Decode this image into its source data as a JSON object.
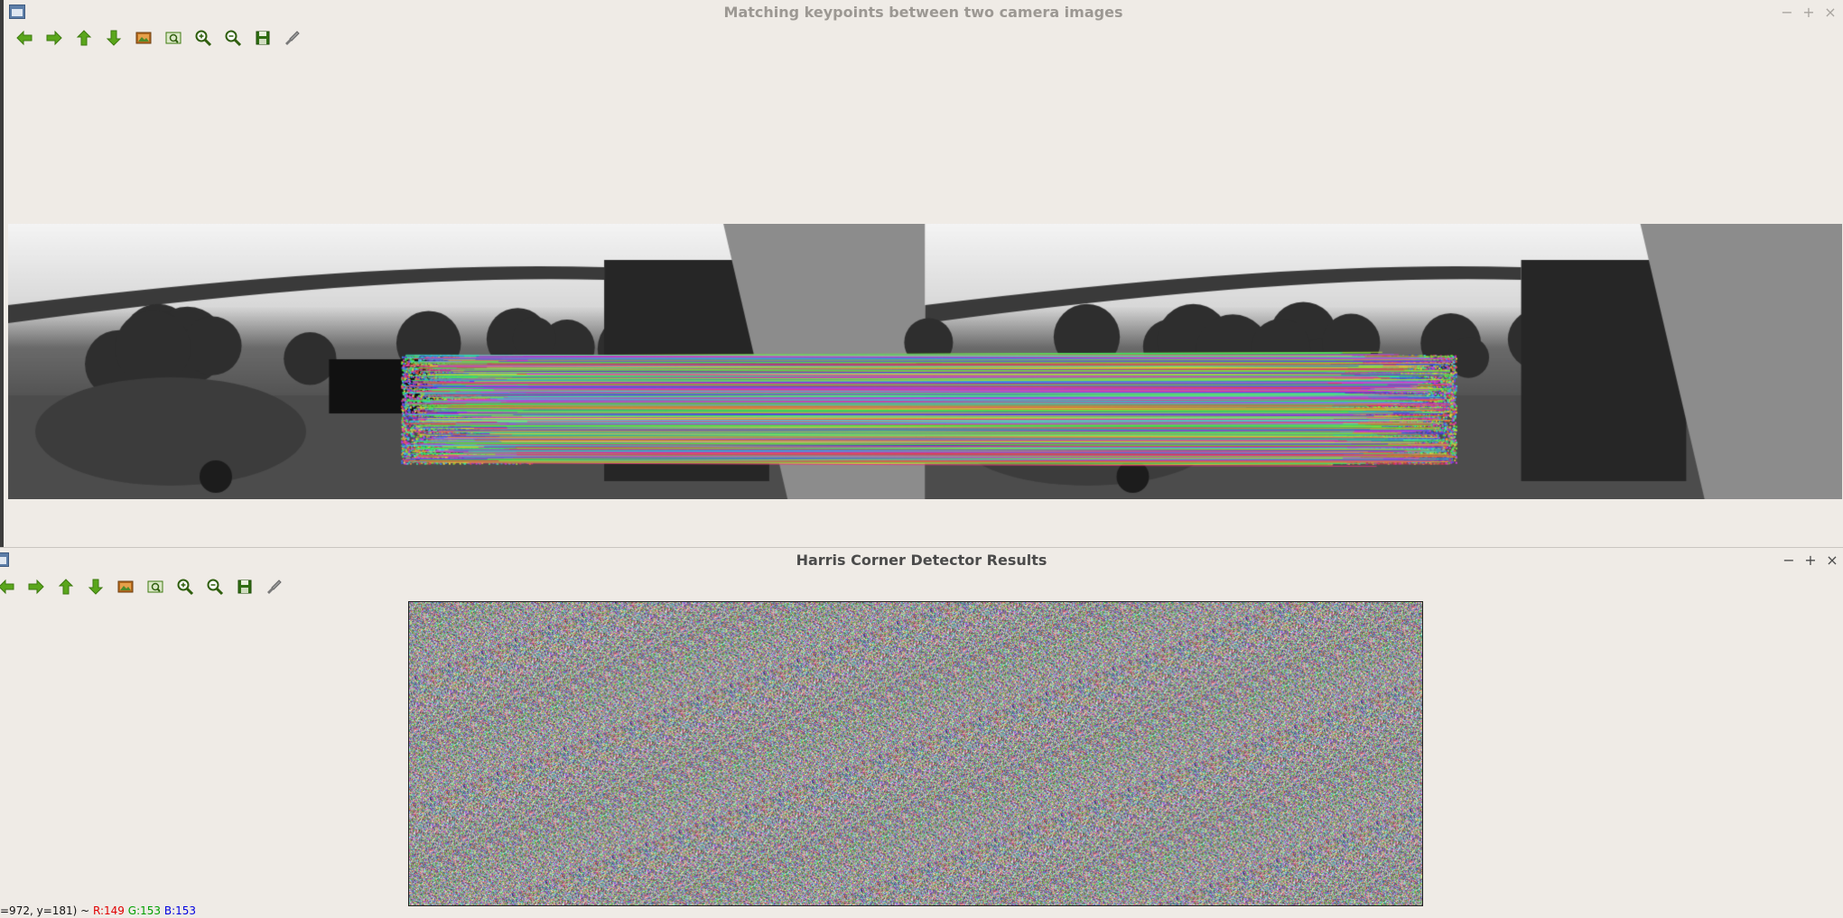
{
  "window_top": {
    "title": "Matching keypoints between two camera images"
  },
  "window_bottom": {
    "title": "Harris Corner Detector Results",
    "status": {
      "coords": "=972, y=181) ~ ",
      "r": "R:149",
      "g": "G:153",
      "b": "B:153"
    }
  },
  "window_buttons": {
    "minimize": "−",
    "maximize": "+",
    "close": "×"
  },
  "toolbar_icons": [
    "arrow-left-icon",
    "arrow-right-icon",
    "arrow-up-icon",
    "arrow-down-icon",
    "image-icon",
    "zoom-fit-icon",
    "zoom-in-icon",
    "zoom-out-icon",
    "save-icon",
    "properties-icon"
  ],
  "colors": {
    "status_r": "#e00000",
    "status_g": "#00a000",
    "status_b": "#0000e0",
    "toolbar_green": "#5aa61b"
  }
}
